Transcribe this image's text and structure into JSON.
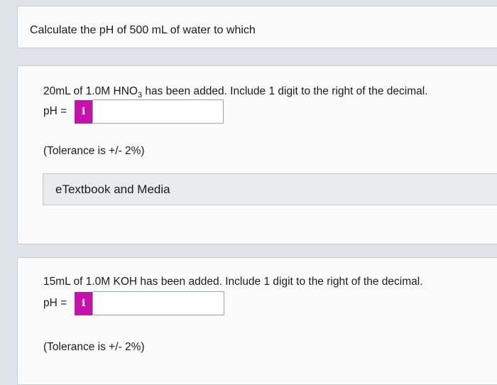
{
  "intro": {
    "text": "Calculate the pH of 500 mL of water to which"
  },
  "part1": {
    "question_prefix": "20mL of 1.0M HNO",
    "question_sub": "3",
    "question_suffix": " has been added. Include 1 digit to the right of the decimal.",
    "ph_label": "pH =",
    "info_icon": "i",
    "input_value": "",
    "tolerance": "(Tolerance is +/- 2%)",
    "etextbook_label": "eTextbook and Media"
  },
  "part2": {
    "question": "15mL of 1.0M KOH has been added. Include 1 digit to the right of the decimal.",
    "ph_label": "pH =",
    "info_icon": "i",
    "input_value": "",
    "tolerance": "(Tolerance is +/- 2%)"
  },
  "colors": {
    "info_button": "#c90faf",
    "background": "#dfe3ea"
  }
}
